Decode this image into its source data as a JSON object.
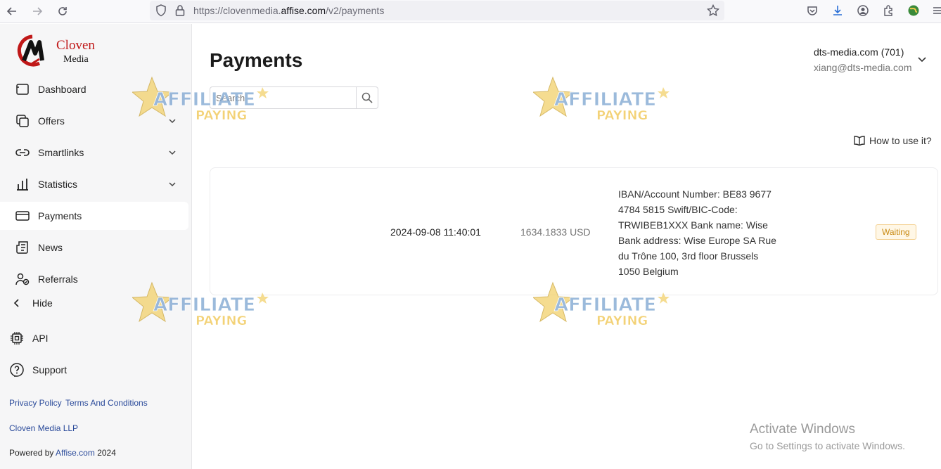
{
  "browser": {
    "url_prefix": "https://clovenmedia.",
    "url_domain": "affise.com",
    "url_path": "/v2/payments"
  },
  "sidebar": {
    "logo_text_1": "Cloven",
    "logo_text_2": "Media",
    "items": [
      {
        "label": "Dashboard",
        "icon": "dashboard-icon"
      },
      {
        "label": "Offers",
        "icon": "offers-icon",
        "expandable": true
      },
      {
        "label": "Smartlinks",
        "icon": "link-icon",
        "expandable": true
      },
      {
        "label": "Statistics",
        "icon": "bar-chart-icon",
        "expandable": true
      },
      {
        "label": "Payments",
        "icon": "card-icon",
        "active": true
      },
      {
        "label": "News",
        "icon": "news-icon"
      },
      {
        "label": "Referrals",
        "icon": "referrals-icon"
      }
    ],
    "hide_label": "Hide",
    "api_label": "API",
    "support_label": "Support",
    "privacy_label": "Privacy Policy",
    "terms_label": "Terms And Conditions",
    "company": "Cloven Media LLP",
    "powered_prefix": "Powered by",
    "powered_link": "Affise.com",
    "powered_year": "2024"
  },
  "main": {
    "title": "Payments",
    "search_placeholder": "Search",
    "how_to": "How to use it?"
  },
  "account": {
    "name": "dts-media.com (701)",
    "email": "xiang@dts-media.com"
  },
  "payment": {
    "date": "2024-09-08 11:40:01",
    "amount": "1634.1833 USD",
    "details": "IBAN/Account Number: BE83 9677 4784 5815 Swift/BIC-Code: TRWIBEB1XXX Bank name: Wise Bank address: Wise Europe SA Rue du Trône 100, 3rd floor Brussels 1050 Belgium",
    "status": "Waiting"
  },
  "watermark": {
    "line1": "AFFILIATE",
    "line2": "PAYING"
  },
  "windows": {
    "activate_title": "Activate Windows",
    "activate_sub": "Go to Settings to activate Windows."
  },
  "colors": {
    "link": "#2a4a9a",
    "badge_text": "#c98a14",
    "badge_bg": "#fff7e6",
    "sidebar_bg": "#f6f6f7"
  }
}
